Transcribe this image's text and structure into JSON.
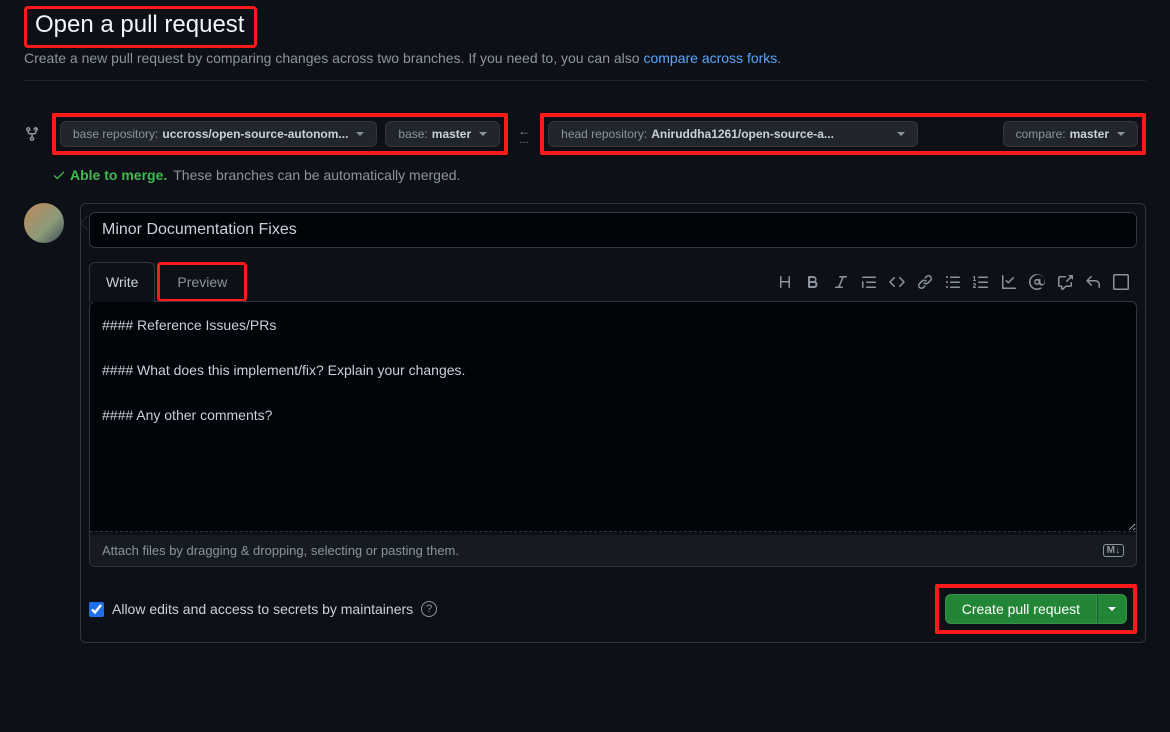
{
  "header": {
    "title": "Open a pull request",
    "subtitle_prefix": "Create a new pull request by comparing changes across two branches. If you need to, you can also ",
    "subtitle_link": "compare across forks",
    "subtitle_suffix": "."
  },
  "branches": {
    "base_repo_label": "base repository:",
    "base_repo_value": "uccross/open-source-autonom...",
    "base_branch_label": "base:",
    "base_branch_value": "master",
    "head_repo_label": "head repository:",
    "head_repo_value": "Aniruddha1261/open-source-a...",
    "compare_label": "compare:",
    "compare_value": "master"
  },
  "merge": {
    "able_text": "Able to merge.",
    "detail_text": "These branches can be automatically merged."
  },
  "form": {
    "title_value": "Minor Documentation Fixes",
    "tabs": {
      "write": "Write",
      "preview": "Preview"
    },
    "body_value": "#### Reference Issues/PRs\n\n#### What does this implement/fix? Explain your changes.\n\n#### Any other comments?",
    "attach_hint": "Attach files by dragging & dropping, selecting or pasting them.",
    "md_badge": "M↓"
  },
  "footer": {
    "allow_edits_label": "Allow edits and access to secrets by maintainers",
    "create_button": "Create pull request"
  }
}
